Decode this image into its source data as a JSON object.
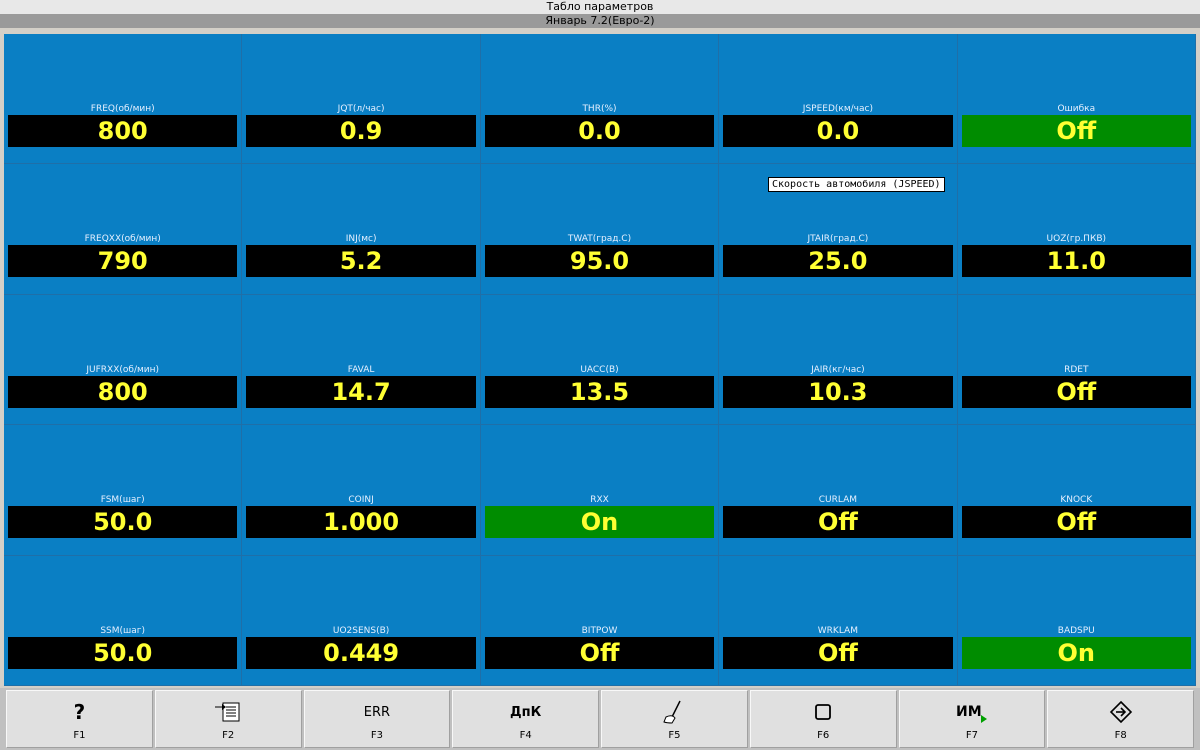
{
  "window": {
    "title": "Табло параметров",
    "subtitle": "Январь 7.2(Евро-2)"
  },
  "tooltip": "Скорость автомобиля (JSPEED)",
  "params": [
    {
      "label": "FREQ(об/мин)",
      "value": "800",
      "green": false
    },
    {
      "label": "JQT(л/час)",
      "value": "0.9",
      "green": false
    },
    {
      "label": "THR(%)",
      "value": "0.0",
      "green": false
    },
    {
      "label": "JSPEED(км/час)",
      "value": "0.0",
      "green": false
    },
    {
      "label": "Ошибка",
      "value": "Off",
      "green": true
    },
    {
      "label": "FREQХХ(об/мин)",
      "value": "790",
      "green": false
    },
    {
      "label": "INJ(мс)",
      "value": "5.2",
      "green": false
    },
    {
      "label": "TWAT(град.С)",
      "value": "95.0",
      "green": false
    },
    {
      "label": "JTAIR(град.С)",
      "value": "25.0",
      "green": false
    },
    {
      "label": "UOZ(гр.ПКВ)",
      "value": "11.0",
      "green": false
    },
    {
      "label": "JUFRХХ(об/мин)",
      "value": "800",
      "green": false
    },
    {
      "label": "FAVAL",
      "value": "14.7",
      "green": false
    },
    {
      "label": "UACC(В)",
      "value": "13.5",
      "green": false
    },
    {
      "label": "JAIR(кг/час)",
      "value": "10.3",
      "green": false
    },
    {
      "label": "RDET",
      "value": "Off",
      "green": false
    },
    {
      "label": "FSM(шаг)",
      "value": "50.0",
      "green": false
    },
    {
      "label": "COINJ",
      "value": "1.000",
      "green": false
    },
    {
      "label": "RХХ",
      "value": "On",
      "green": true
    },
    {
      "label": "CURLAM",
      "value": "Off",
      "green": false
    },
    {
      "label": "KNOCK",
      "value": "Off",
      "green": false
    },
    {
      "label": "SSM(шаг)",
      "value": "50.0",
      "green": false
    },
    {
      "label": "UO2SENS(В)",
      "value": "0.449",
      "green": false
    },
    {
      "label": "BITPOW",
      "value": "Off",
      "green": false
    },
    {
      "label": "WRKLAM",
      "value": "Off",
      "green": false
    },
    {
      "label": "BADSPU",
      "value": "On",
      "green": true
    }
  ],
  "fkeys": [
    {
      "key": "F1",
      "icon_text": "?",
      "icon": "help-icon"
    },
    {
      "key": "F2",
      "icon_text": "",
      "icon": "import-list-icon"
    },
    {
      "key": "F3",
      "icon_text": "ERR",
      "icon": "error-icon"
    },
    {
      "key": "F4",
      "icon_text": "ДпК",
      "icon": "dpk-icon"
    },
    {
      "key": "F5",
      "icon_text": "",
      "icon": "brush-icon"
    },
    {
      "key": "F6",
      "icon_text": "",
      "icon": "square-icon"
    },
    {
      "key": "F7",
      "icon_text": "ИМ",
      "icon": "im-play-icon"
    },
    {
      "key": "F8",
      "icon_text": "",
      "icon": "exit-icon"
    }
  ],
  "colors": {
    "panel": "#0a7fc4",
    "value_bg": "#000000",
    "value_green_bg": "#008c00",
    "value_text": "#ffff33"
  }
}
